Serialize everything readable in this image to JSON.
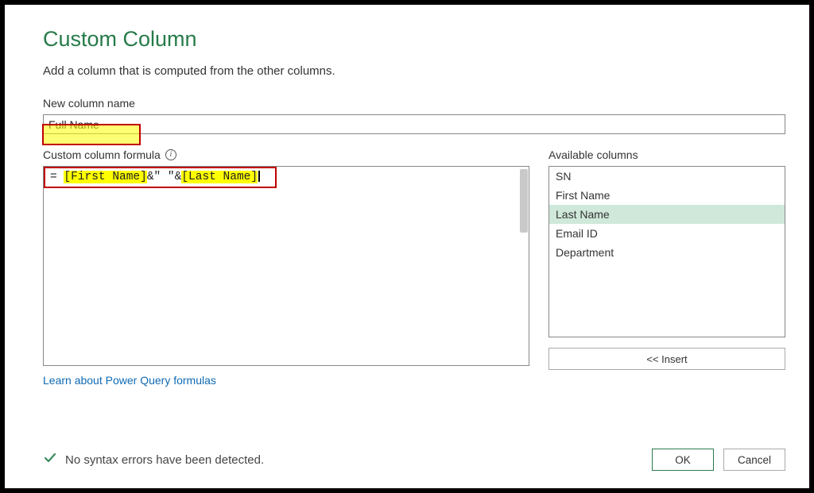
{
  "dialog": {
    "title": "Custom Column",
    "subtitle": "Add a column that is computed from the other columns."
  },
  "nameSection": {
    "label": "New column name",
    "value": "Full Name"
  },
  "formulaSection": {
    "label": "Custom column formula",
    "prefix": "= ",
    "ref1": "[First Name]",
    "mid": "&\" \"&",
    "ref2": "[Last Name]"
  },
  "availableSection": {
    "label": "Available columns",
    "items": {
      "0": "SN",
      "1": "First Name",
      "2": "Last Name",
      "3": "Email ID",
      "4": "Department"
    },
    "insertLabel": "<< Insert"
  },
  "link": {
    "label": "Learn about Power Query formulas"
  },
  "status": {
    "text": "No syntax errors have been detected."
  },
  "buttons": {
    "ok": "OK",
    "cancel": "Cancel"
  }
}
